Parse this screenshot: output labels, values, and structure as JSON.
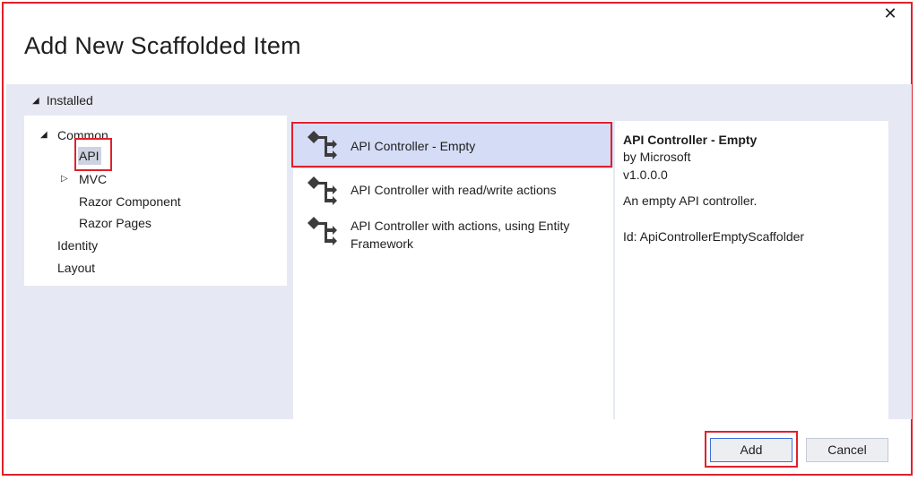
{
  "dialog": {
    "title": "Add New Scaffolded Item",
    "close_label": "✕"
  },
  "sidebar": {
    "installed_label": "Installed",
    "tree": {
      "common": "Common",
      "api": "API",
      "mvc": "MVC",
      "razor_component": "Razor Component",
      "razor_pages": "Razor Pages",
      "identity": "Identity",
      "layout": "Layout"
    }
  },
  "templates": [
    {
      "label": "API Controller - Empty",
      "selected": true
    },
    {
      "label": "API Controller with read/write actions",
      "selected": false
    },
    {
      "label": "API Controller with actions, using Entity Framework",
      "selected": false
    }
  ],
  "details": {
    "name": "API Controller - Empty",
    "author": "by Microsoft",
    "version": "v1.0.0.0",
    "description": "An empty API controller.",
    "id": "Id: ApiControllerEmptyScaffolder"
  },
  "footer": {
    "add_label": "Add",
    "cancel_label": "Cancel"
  },
  "colors": {
    "highlight_border": "#e0212b",
    "selected_row": "#d5dcf6",
    "panel_background": "#e6e9f3"
  },
  "icons": {
    "template": "controller-icon",
    "close": "close-icon"
  }
}
